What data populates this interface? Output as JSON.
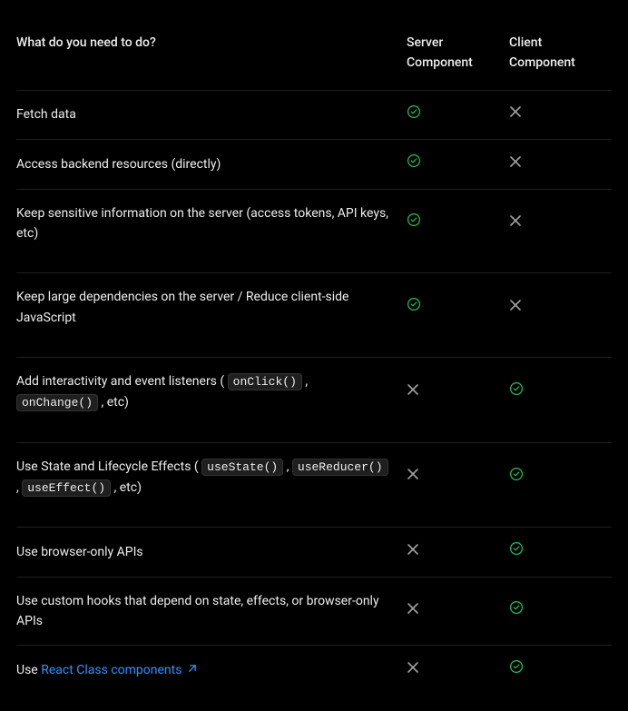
{
  "headers": {
    "task": "What do you need to do?",
    "server_line1": "Server",
    "server_line2": "Component",
    "client_line1": "Client",
    "client_line2": "Component"
  },
  "rows": [
    {
      "parts": [
        {
          "type": "text",
          "value": "Fetch data"
        }
      ],
      "server": true,
      "client": false,
      "tall": false
    },
    {
      "parts": [
        {
          "type": "text",
          "value": "Access backend resources (directly)"
        }
      ],
      "server": true,
      "client": false,
      "tall": false
    },
    {
      "parts": [
        {
          "type": "text",
          "value": "Keep sensitive information on the server (access tokens, API keys, etc)"
        }
      ],
      "server": true,
      "client": false,
      "tall": true
    },
    {
      "parts": [
        {
          "type": "text",
          "value": "Keep large dependencies on the server / Reduce client-side JavaScript"
        }
      ],
      "server": true,
      "client": false,
      "tall": true
    },
    {
      "parts": [
        {
          "type": "text",
          "value": "Add interactivity and event listeners ( "
        },
        {
          "type": "code",
          "value": "onClick()"
        },
        {
          "type": "text",
          "value": " , "
        },
        {
          "type": "code",
          "value": "onChange()"
        },
        {
          "type": "text",
          "value": " , etc)"
        }
      ],
      "server": false,
      "client": true,
      "tall": true
    },
    {
      "parts": [
        {
          "type": "text",
          "value": "Use State and Lifecycle Effects ( "
        },
        {
          "type": "code",
          "value": "useState()"
        },
        {
          "type": "text",
          "value": " , "
        },
        {
          "type": "code",
          "value": "useReducer()"
        },
        {
          "type": "text",
          "value": " , "
        },
        {
          "type": "code",
          "value": "useEffect()"
        },
        {
          "type": "text",
          "value": " , etc)"
        }
      ],
      "server": false,
      "client": true,
      "tall": true
    },
    {
      "parts": [
        {
          "type": "text",
          "value": "Use browser-only APIs"
        }
      ],
      "server": false,
      "client": true,
      "tall": false
    },
    {
      "parts": [
        {
          "type": "text",
          "value": "Use custom hooks that depend on state, effects, or browser-only APIs"
        }
      ],
      "server": false,
      "client": true,
      "tall": false
    },
    {
      "parts": [
        {
          "type": "text",
          "value": "Use "
        },
        {
          "type": "link",
          "value": "React Class components"
        }
      ],
      "server": false,
      "client": true,
      "tall": false
    }
  ],
  "check_color": "#22c55e",
  "x_color": "#a1a1a1"
}
